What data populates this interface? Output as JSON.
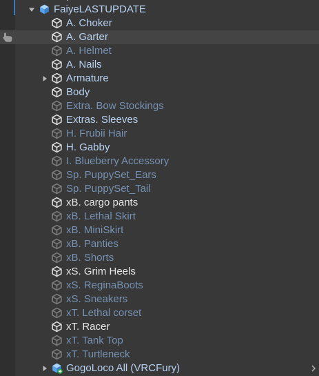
{
  "hierarchy": {
    "root": {
      "label": "FaiyeLASTUPDATE",
      "icon": "prefab-cube-icon",
      "expanded": true
    },
    "items": [
      {
        "label": "A. Choker",
        "state": "prefab",
        "icon": "cube-icon"
      },
      {
        "label": "A. Garter",
        "state": "prefab",
        "icon": "cube-icon",
        "selected": true,
        "hovered": true
      },
      {
        "label": "A. Helmet",
        "state": "inactive",
        "icon": "cube-icon"
      },
      {
        "label": "A. Nails",
        "state": "prefab",
        "icon": "cube-icon"
      },
      {
        "label": "Armature",
        "state": "prefab",
        "icon": "cube-icon",
        "has_children": true,
        "expanded": false
      },
      {
        "label": "Body",
        "state": "prefab",
        "icon": "cube-icon"
      },
      {
        "label": "Extra. Bow Stockings",
        "state": "inactive",
        "icon": "cube-icon"
      },
      {
        "label": "Extras. Sleeves",
        "state": "prefab",
        "icon": "cube-icon"
      },
      {
        "label": "H. Frubii Hair",
        "state": "inactive",
        "icon": "cube-icon"
      },
      {
        "label": "H. Gabby",
        "state": "prefab",
        "icon": "cube-icon"
      },
      {
        "label": "I. Blueberry Accessory",
        "state": "inactive",
        "icon": "cube-icon"
      },
      {
        "label": "Sp. PuppySet_Ears",
        "state": "inactive",
        "icon": "cube-icon"
      },
      {
        "label": "Sp. PuppySet_Tail",
        "state": "inactive",
        "icon": "cube-icon"
      },
      {
        "label": "xB. cargo pants",
        "state": "active",
        "icon": "cube-icon"
      },
      {
        "label": "xB. Lethal Skirt",
        "state": "inactive",
        "icon": "cube-icon"
      },
      {
        "label": "xB. MiniSkirt",
        "state": "inactive",
        "icon": "cube-icon"
      },
      {
        "label": "xB. Panties",
        "state": "inactive",
        "icon": "cube-icon"
      },
      {
        "label": "xB. Shorts",
        "state": "inactive",
        "icon": "cube-icon"
      },
      {
        "label": "xS. Grim Heels",
        "state": "active",
        "icon": "cube-icon"
      },
      {
        "label": "xS. ReginaBoots",
        "state": "inactive",
        "icon": "cube-icon"
      },
      {
        "label": "xS. Sneakers",
        "state": "inactive",
        "icon": "cube-icon"
      },
      {
        "label": "xT. Lethal corset",
        "state": "inactive",
        "icon": "cube-icon"
      },
      {
        "label": "xT. Racer",
        "state": "active",
        "icon": "cube-icon"
      },
      {
        "label": "xT. Tank Top",
        "state": "inactive",
        "icon": "cube-icon"
      },
      {
        "label": "xT. Turtleneck",
        "state": "inactive",
        "icon": "cube-icon"
      },
      {
        "label": "GogoLoco All (VRCFury)",
        "state": "prefab",
        "icon": "vrcfury-cube-icon",
        "has_children": true,
        "expanded": false
      }
    ]
  },
  "colors": {
    "background": "#383838",
    "selected_row": "#444444",
    "active_text": "#e6e6e6",
    "prefab_text": "#b8d1f2",
    "inactive_text": "#7791b3",
    "accent": "#3a79bb"
  }
}
